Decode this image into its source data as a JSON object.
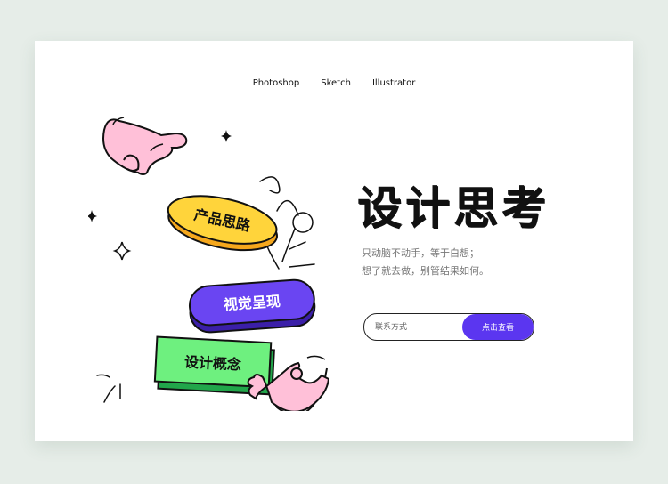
{
  "nav": {
    "items": [
      "Photoshop",
      "Sketch",
      "Illustrator"
    ]
  },
  "hero": {
    "title": "设计思考",
    "description_lines": [
      "只动脑不动手，等于白想；",
      "想了就去做，别管结果如何。"
    ]
  },
  "illustration": {
    "pills": [
      {
        "label": "产品思路",
        "color": "#ffd43b"
      },
      {
        "label": "视觉呈现",
        "color": "#6a45f2"
      },
      {
        "label": "设计概念",
        "color": "#6ef07f"
      }
    ],
    "hand_color": "#ffc0d8"
  },
  "subscribe": {
    "placeholder": "联系方式",
    "button_label": "点击查看",
    "accent": "#5b36f0"
  }
}
